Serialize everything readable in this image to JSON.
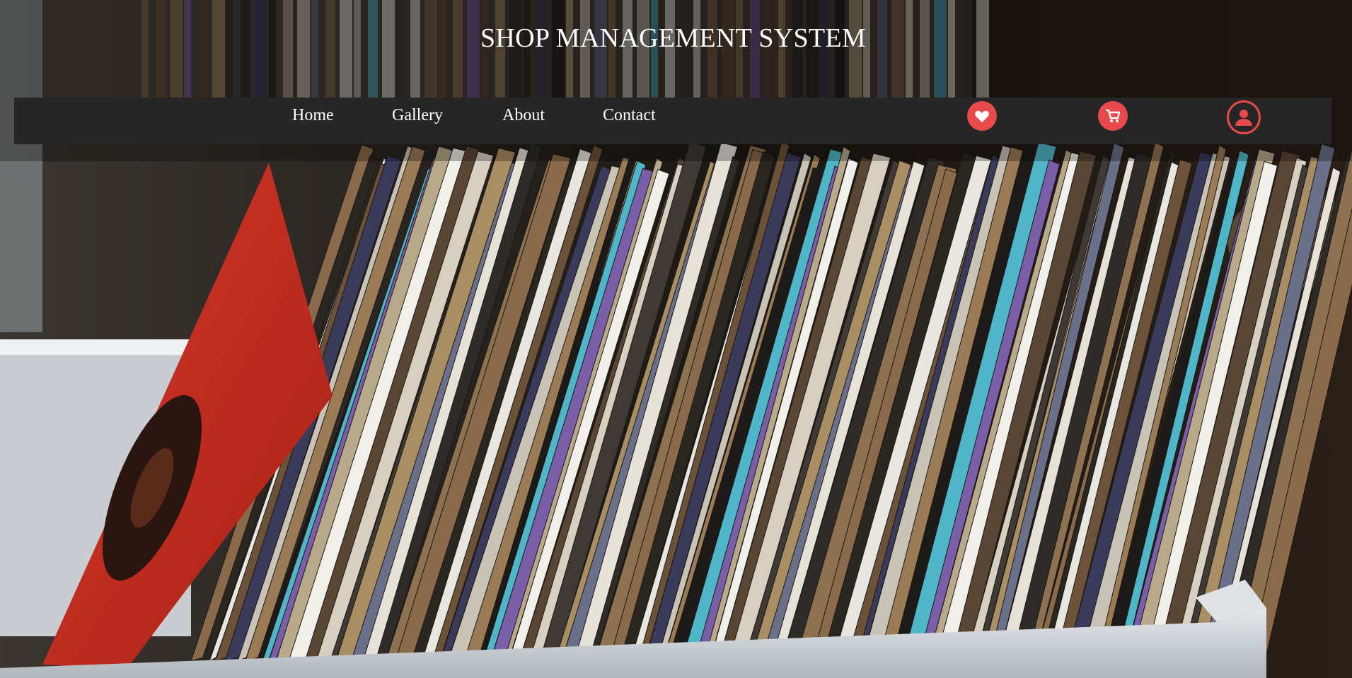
{
  "header": {
    "title": "SHOP MANAGEMENT SYSTEM"
  },
  "nav": {
    "items": [
      {
        "label": "Home"
      },
      {
        "label": "Gallery"
      },
      {
        "label": "About"
      },
      {
        "label": "Contact"
      }
    ]
  },
  "actions": {
    "icons": [
      "heart-icon",
      "cart-icon",
      "user-icon"
    ],
    "accent_color": "#e8494a"
  },
  "colors": {
    "navbar_bg": "#262626",
    "title_text": "#ffffff"
  },
  "hero": {
    "subject": "vinyl-records-background-image"
  }
}
